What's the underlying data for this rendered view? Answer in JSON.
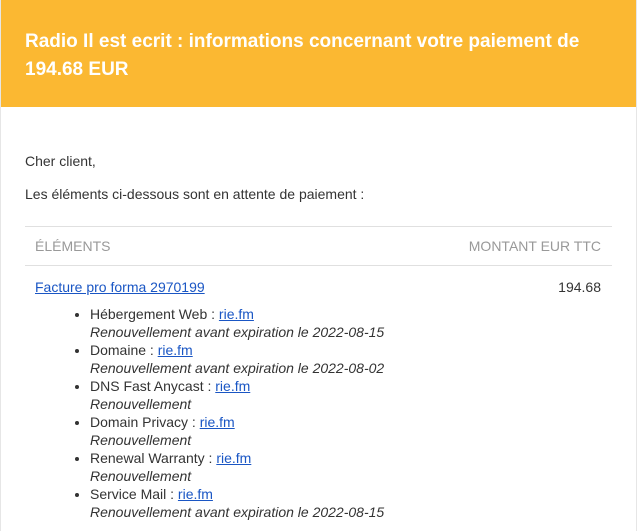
{
  "header": {
    "title": "Radio Il est ecrit : informations concernant votre paiement de 194.68 EUR",
    "background_color": "#fbb832"
  },
  "body": {
    "greeting": "Cher client,",
    "intro": "Les éléments ci-dessous sont en attente de paiement :"
  },
  "table": {
    "col_items": "ÉLÉMENTS",
    "col_amount": "MONTANT EUR TTC",
    "invoice": {
      "label": "Facture pro forma 2970199",
      "amount": "194.68"
    },
    "items": [
      {
        "name": "Hébergement Web :",
        "link": "rie.fm",
        "note": "Renouvellement avant expiration le 2022-08-15"
      },
      {
        "name": "Domaine :",
        "link": "rie.fm",
        "note": "Renouvellement avant expiration le 2022-08-02"
      },
      {
        "name": "DNS Fast Anycast :",
        "link": "rie.fm",
        "note": "Renouvellement"
      },
      {
        "name": "Domain Privacy :",
        "link": "rie.fm",
        "note": "Renouvellement"
      },
      {
        "name": "Renewal Warranty :",
        "link": "rie.fm",
        "note": "Renouvellement"
      },
      {
        "name": "Service Mail :",
        "link": "rie.fm",
        "note": "Renouvellement avant expiration le 2022-08-15"
      }
    ]
  },
  "colors": {
    "link": "#1a56c4",
    "header_text": "#ffffff",
    "muted": "#999999"
  }
}
